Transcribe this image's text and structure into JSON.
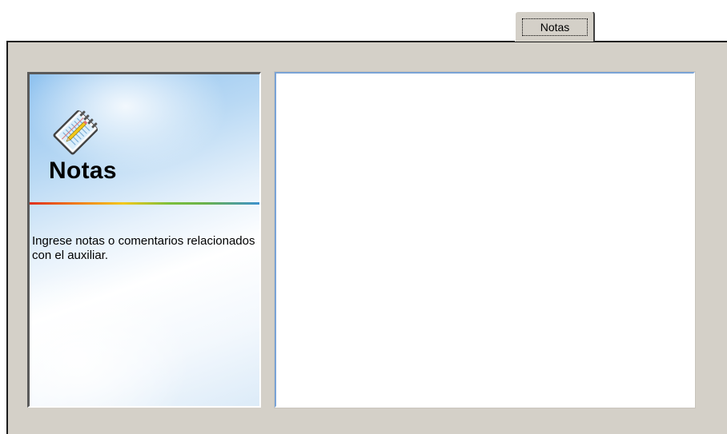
{
  "tabs": [
    {
      "label": "Notas",
      "selected": true
    }
  ],
  "info_panel": {
    "icon": "notebook-icon",
    "title": "Notas",
    "description": "Ingrese notas o comentarios relacionados con el auxiliar."
  },
  "notes": {
    "value": ""
  },
  "colors": {
    "dialog_bg": "#d4d0c8",
    "panel_gradient_start": "#8fc2ef",
    "textarea_border": "#7aa3d6"
  }
}
